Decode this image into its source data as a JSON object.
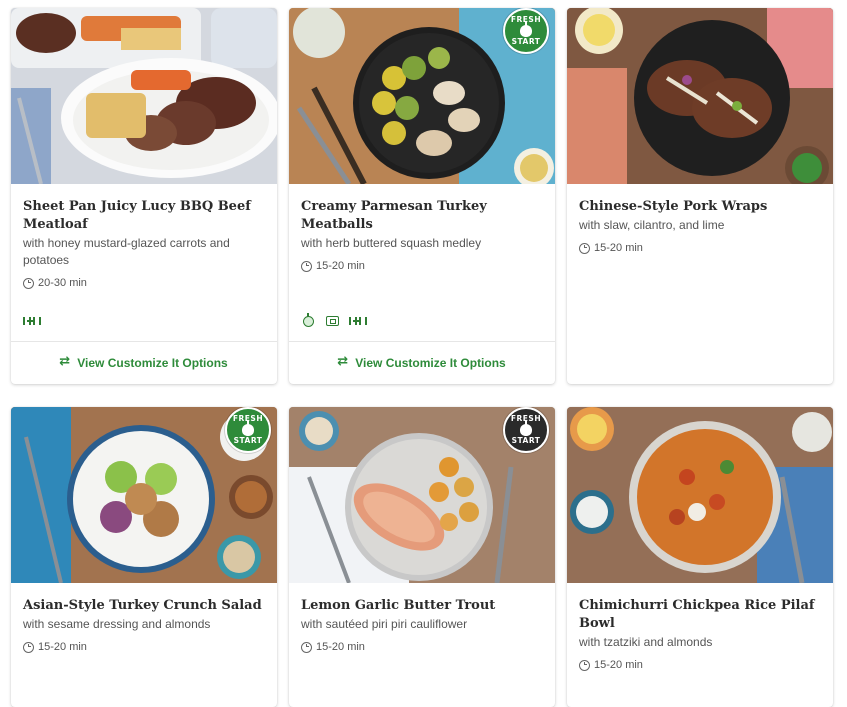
{
  "badge": {
    "line1": "FRESH",
    "line2": "START"
  },
  "cards": [
    {
      "title": "Sheet Pan Juicy Lucy BBQ Beef Meatloaf",
      "subtitle": "with honey mustard-glazed carrots and potatoes",
      "time": "20-30 min",
      "fresh_start": false,
      "tags": [
        "dumbbell-icon"
      ],
      "customize": "View Customize It Options"
    },
    {
      "title": "Creamy Parmesan Turkey Meatballs",
      "subtitle": "with herb buttered squash medley",
      "time": "15-20 min",
      "fresh_start": true,
      "tags": [
        "apple-icon",
        "sheet-pan-icon",
        "dumbbell-icon"
      ],
      "customize": "View Customize It Options"
    },
    {
      "title": "Chinese-Style Pork Wraps",
      "subtitle": "with slaw, cilantro, and lime",
      "time": "15-20 min",
      "fresh_start": false,
      "tags": [],
      "customize": ""
    },
    {
      "title": "Asian-Style Turkey Crunch Salad",
      "subtitle": "with sesame dressing and almonds",
      "time": "15-20 min",
      "fresh_start": true
    },
    {
      "title": "Lemon Garlic Butter Trout",
      "subtitle": "with sautéed piri piri cauliflower",
      "time": "15-20 min",
      "fresh_start": true
    },
    {
      "title": "Chimichurri Chickpea Rice Pilaf Bowl",
      "subtitle": "with tzatziki and almonds",
      "time": "15-20 min",
      "fresh_start": false
    }
  ],
  "colors": {
    "brand_green": "#2e8b3a",
    "badge_green": "#2e8b3a",
    "title": "#2b2b2b",
    "text": "#555555"
  }
}
